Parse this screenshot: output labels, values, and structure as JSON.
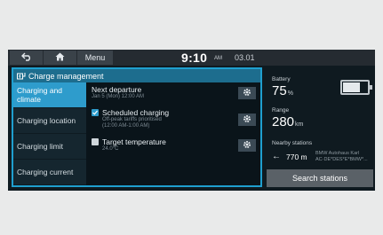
{
  "topbar": {
    "back_icon": "back-arrow-icon",
    "home_icon": "home-icon",
    "menu_label": "Menu",
    "time": "9:10",
    "ampm": "AM",
    "date": "03.01"
  },
  "panel": {
    "title": "Charge management",
    "title_icon": "charging-plug-icon",
    "sidebar": [
      {
        "label": "Charging and climate",
        "active": true
      },
      {
        "label": "Charging location",
        "active": false
      },
      {
        "label": "Charging limit",
        "active": false
      },
      {
        "label": "Charging current",
        "active": false
      }
    ],
    "rows": [
      {
        "title": "Next departure",
        "sub": "Jan 5 (Mon) 12:00 AM"
      },
      {
        "title": "Scheduled charging",
        "sub1": "Off-peak tariffs prioritised",
        "sub2": "(12:00 AM-1:00 AM)",
        "checked": true
      },
      {
        "title": "Target temperature",
        "sub": "24.0°C",
        "checked": false
      }
    ],
    "settings_icon": "gear-icon"
  },
  "info": {
    "battery_label": "Battery",
    "battery_value": "75",
    "battery_unit": "%",
    "battery_level": 0.75,
    "range_label": "Range",
    "range_value": "280",
    "range_unit": "km",
    "nearby_label": "Nearby stations",
    "distance": "770 m",
    "station_name": "BMW Autohaus Karl",
    "station_sub": "AC·DE*DES*E*BMW*...",
    "search_label": "Search stations"
  },
  "colors": {
    "accent": "#2e9ccc",
    "panel_border": "#1f9fcf",
    "background": "#0f1a20"
  }
}
